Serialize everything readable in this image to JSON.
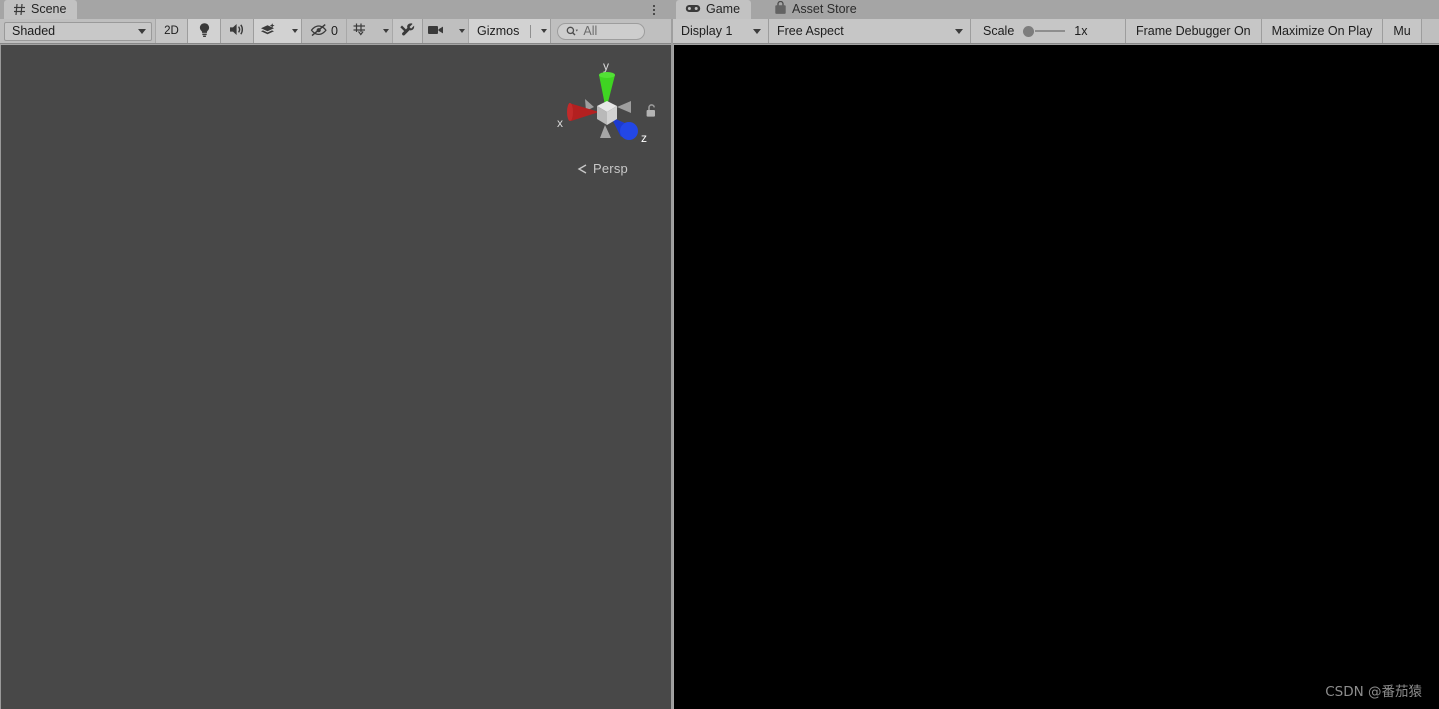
{
  "scene_panel": {
    "tabs": [
      {
        "label": "Scene",
        "icon": "grid-icon",
        "active": true
      }
    ],
    "menu_icon": "kebab-menu-icon",
    "toolbar": {
      "draw_mode": {
        "label": "Shaded",
        "icon": "chevron-down-icon"
      },
      "mode_2d": {
        "label": "2D"
      },
      "lighting": {
        "icon": "lightbulb-icon",
        "label": ""
      },
      "audio": {
        "icon": "speaker-icon",
        "label": ""
      },
      "fx": {
        "icon": "layers-fx-icon",
        "label": ""
      },
      "hidden_objects": {
        "icon": "eye-off-icon",
        "label": "0"
      },
      "grid": {
        "icon": "grid-snap-icon",
        "label": ""
      },
      "tools": {
        "icon": "wrench-tools-icon",
        "label": ""
      },
      "camera": {
        "icon": "camera-icon",
        "label": ""
      },
      "gizmos": {
        "label": "Gizmos",
        "icon": "chevron-down-icon"
      },
      "search": {
        "value": "",
        "placeholder": "All",
        "icon": "search-icon"
      }
    },
    "viewport": {
      "projection_label": "Persp",
      "projection_icon": "left-chevron-icon",
      "lock_icon": "padlock-open-icon",
      "axis_labels": {
        "x": "x",
        "y": "y",
        "z": "z"
      },
      "axis_colors": {
        "x": "#b32020",
        "y": "#3fd422",
        "z": "#1c3ad0",
        "neutral": "#b0b0b0"
      },
      "background_color": "#484848"
    }
  },
  "game_panel": {
    "tabs": [
      {
        "label": "Game",
        "icon": "gamepad-icon",
        "active": true
      },
      {
        "label": "Asset Store",
        "icon": "shopping-bag-icon",
        "active": false
      }
    ],
    "menu_icon": "kebab-menu-icon",
    "toolbar": {
      "display": {
        "label": "Display 1",
        "icon": "chevron-down-icon"
      },
      "aspect": {
        "label": "Free Aspect",
        "icon": "chevron-down-icon"
      },
      "scale": {
        "label": "Scale",
        "value": "1x"
      },
      "frame_debugger": {
        "label": "Frame Debugger On"
      },
      "maximize_on_play": {
        "label": "Maximize On Play"
      },
      "mute_audio": {
        "label": "Mu"
      }
    },
    "viewport": {
      "background_color": "#000000",
      "watermark": "CSDN @番茄猿"
    }
  },
  "theme": {
    "tabstrip_bg": "#a5a5a5",
    "tab_active_bg": "#c2c2c2",
    "toolbar_bg": "#bfbfbf",
    "button_bg": "#c6c6c6",
    "text": "#1d1d1d"
  }
}
